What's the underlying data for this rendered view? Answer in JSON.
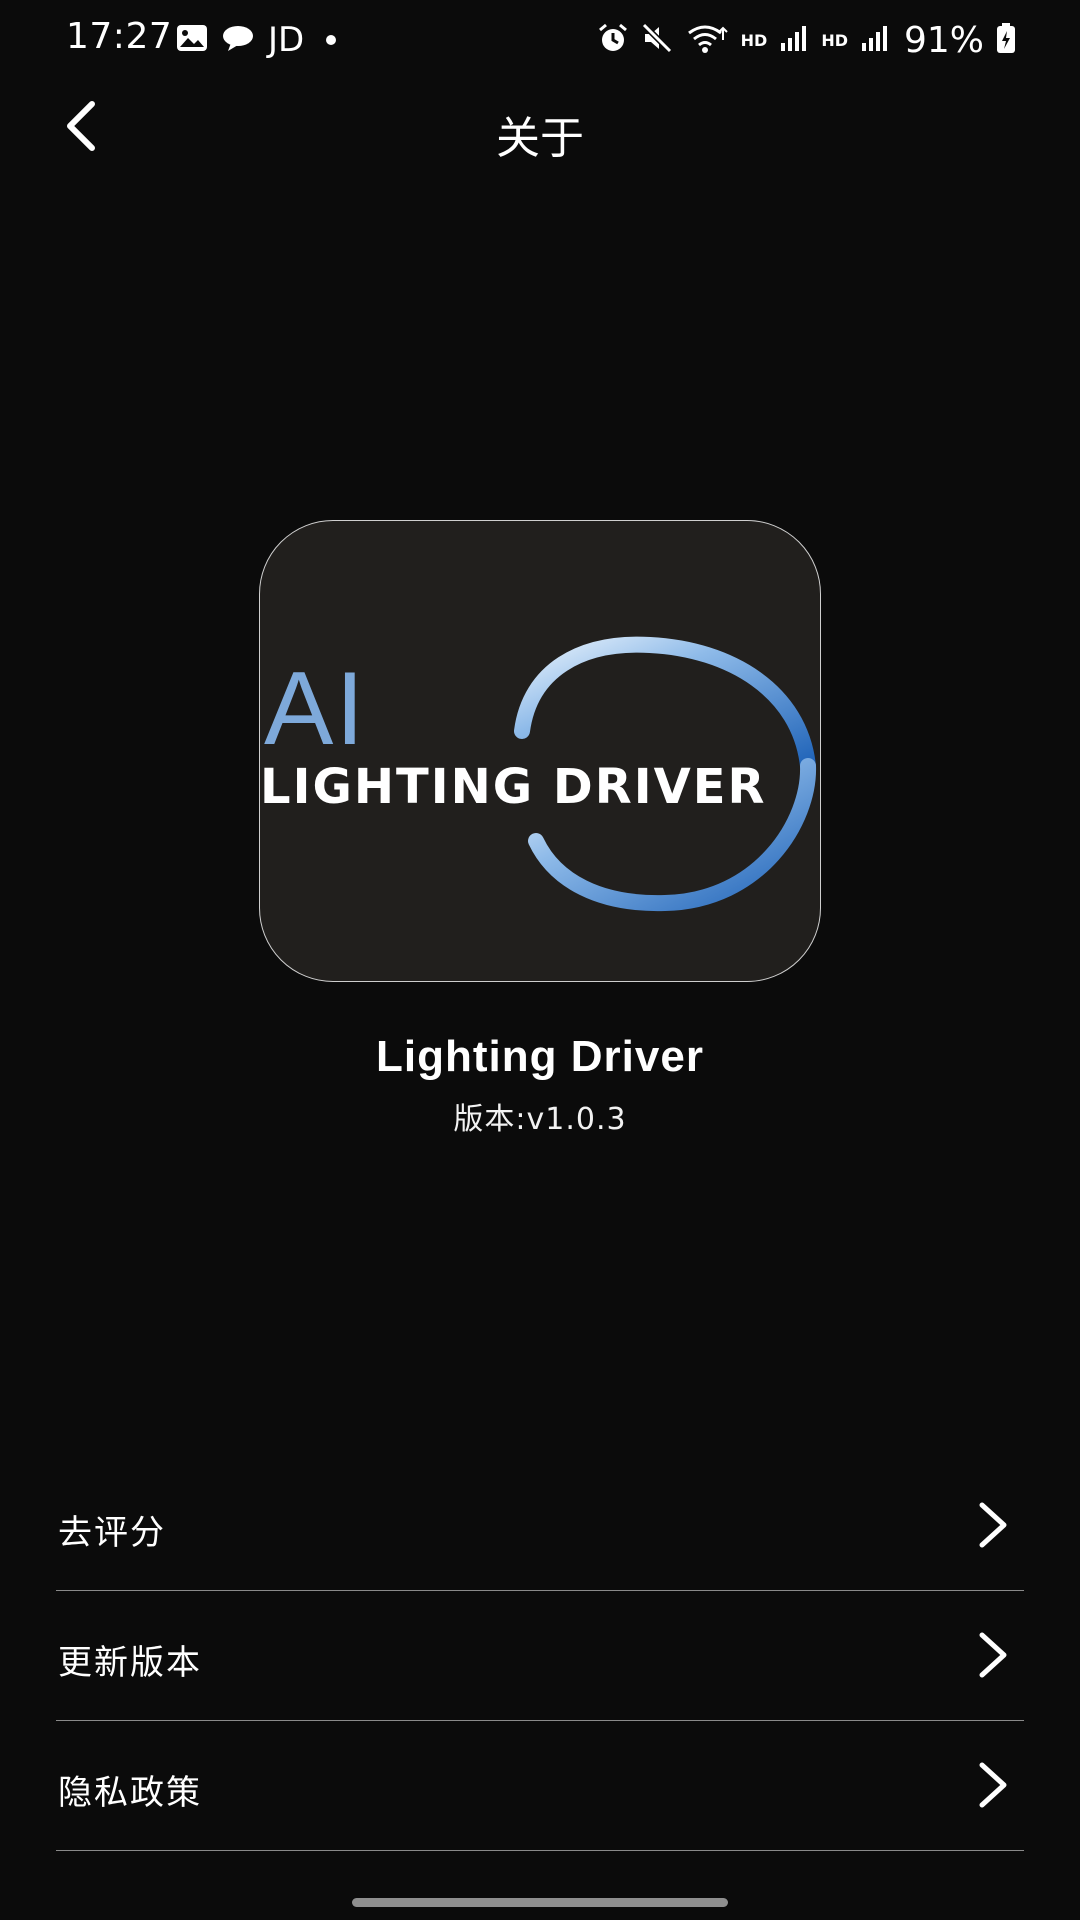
{
  "status_bar": {
    "time": "17:27",
    "carrier": "JD",
    "battery": "91%",
    "hd_1": "HD",
    "hd_2": "HD",
    "icons": [
      "image-icon",
      "chat-icon",
      "dot-icon",
      "alarm-icon",
      "mute-icon",
      "wifi-icon",
      "signal-icon",
      "battery-icon"
    ]
  },
  "header": {
    "title": "关于",
    "back_icon": "chevron-left-icon"
  },
  "logo": {
    "ai_text": "AI",
    "title_text": "LIGHTING DRIVER",
    "colors": {
      "background": "#211f1d",
      "ring_light": "#cfe2f7",
      "ring_dark": "#1f63b8",
      "ai": "#7ea9da"
    }
  },
  "app": {
    "name": "Lighting Driver",
    "version": "版本:v1.0.3"
  },
  "menu": {
    "items": [
      {
        "label": "去评分",
        "icon": "chevron-right-icon"
      },
      {
        "label": "更新版本",
        "icon": "chevron-right-icon"
      },
      {
        "label": "隐私政策",
        "icon": "chevron-right-icon"
      }
    ]
  },
  "colors": {
    "page_background": "#0b0b0b",
    "text": "#ffffff",
    "divider": "#8a8a8a"
  }
}
